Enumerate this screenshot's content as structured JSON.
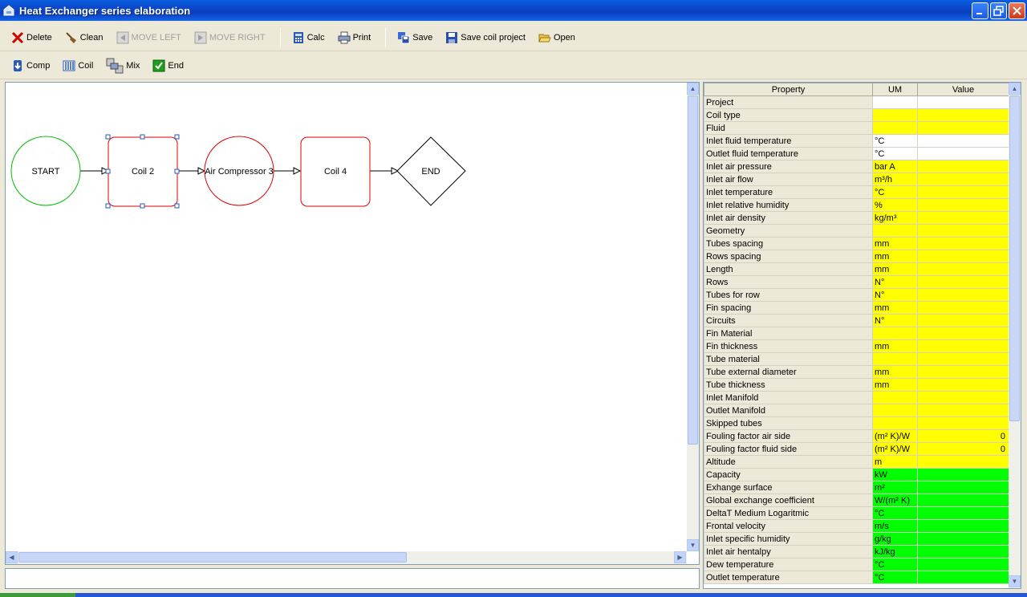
{
  "window": {
    "title": "Heat Exchanger series elaboration"
  },
  "toolbar1": [
    {
      "label": "Delete",
      "icon": "delete-icon",
      "enabled": true
    },
    {
      "label": "Clean",
      "icon": "broom-icon",
      "enabled": true
    },
    {
      "label": "MOVE LEFT",
      "icon": "move-left-icon",
      "enabled": false
    },
    {
      "label": "MOVE RIGHT",
      "icon": "move-right-icon",
      "enabled": false
    },
    {
      "label": "Calc",
      "icon": "calculator-icon",
      "enabled": true
    },
    {
      "label": "Print",
      "icon": "printer-icon",
      "enabled": true
    },
    {
      "label": "Save",
      "icon": "save-icon",
      "enabled": true
    },
    {
      "label": "Save coil project",
      "icon": "floppy-icon",
      "enabled": true
    },
    {
      "label": "Open",
      "icon": "folder-open-icon",
      "enabled": true
    }
  ],
  "toolbar2": [
    {
      "label": "Comp",
      "icon": "compressor-icon"
    },
    {
      "label": "Coil",
      "icon": "coil-icon"
    },
    {
      "label": "Mix",
      "icon": "mix-icon"
    },
    {
      "label": "End",
      "icon": "end-check-icon"
    }
  ],
  "diagram": {
    "nodes": [
      {
        "label": "START",
        "shape": "circle",
        "color": "#00c000"
      },
      {
        "label": "Coil 2",
        "shape": "rounded-rect",
        "color": "#e00000",
        "selected": true
      },
      {
        "label": "Air Compressor 3",
        "shape": "circle",
        "color": "#e00000"
      },
      {
        "label": "Coil 4",
        "shape": "rounded-rect",
        "color": "#e00000"
      },
      {
        "label": "END",
        "shape": "diamond",
        "color": "#000000"
      }
    ]
  },
  "grid": {
    "headers": {
      "property": "Property",
      "um": "UM",
      "value": "Value"
    },
    "rows": [
      {
        "property": "Project",
        "um": "",
        "value": "",
        "color": "white"
      },
      {
        "property": "Coil type",
        "um": "",
        "value": "",
        "color": "yellow"
      },
      {
        "property": "Fluid",
        "um": "",
        "value": "",
        "color": "yellow"
      },
      {
        "property": "Inlet fluid temperature",
        "um": "°C",
        "value": "",
        "color": "white"
      },
      {
        "property": "Outlet fluid temperature",
        "um": "°C",
        "value": "",
        "color": "white"
      },
      {
        "property": "Inlet air pressure",
        "um": "bar A",
        "value": "",
        "color": "yellow"
      },
      {
        "property": "Inlet air flow",
        "um": "m³/h",
        "value": "",
        "color": "yellow"
      },
      {
        "property": "Inlet temperature",
        "um": "°C",
        "value": "",
        "color": "yellow"
      },
      {
        "property": "Inlet relative humidity",
        "um": "%",
        "value": "",
        "color": "yellow"
      },
      {
        "property": "Inlet air density",
        "um": "kg/m³",
        "value": "",
        "color": "yellow"
      },
      {
        "property": "Geometry",
        "um": "",
        "value": "",
        "color": "yellow"
      },
      {
        "property": "Tubes spacing",
        "um": "mm",
        "value": "",
        "color": "yellow"
      },
      {
        "property": "Rows spacing",
        "um": "mm",
        "value": "",
        "color": "yellow"
      },
      {
        "property": "Length",
        "um": "mm",
        "value": "",
        "color": "yellow"
      },
      {
        "property": "Rows",
        "um": "N°",
        "value": "",
        "color": "yellow"
      },
      {
        "property": "Tubes for row",
        "um": "N°",
        "value": "",
        "color": "yellow"
      },
      {
        "property": "Fin spacing",
        "um": "mm",
        "value": "",
        "color": "yellow"
      },
      {
        "property": "Circuits",
        "um": "N°",
        "value": "",
        "color": "yellow"
      },
      {
        "property": "Fin Material",
        "um": "",
        "value": "",
        "color": "yellow"
      },
      {
        "property": "Fin thickness",
        "um": "mm",
        "value": "",
        "color": "yellow"
      },
      {
        "property": "Tube material",
        "um": "",
        "value": "",
        "color": "yellow"
      },
      {
        "property": "Tube external diameter",
        "um": "mm",
        "value": "",
        "color": "yellow"
      },
      {
        "property": "Tube thickness",
        "um": "mm",
        "value": "",
        "color": "yellow"
      },
      {
        "property": "Inlet Manifold",
        "um": "",
        "value": "",
        "color": "yellow"
      },
      {
        "property": "Outlet Manifold",
        "um": "",
        "value": "",
        "color": "yellow"
      },
      {
        "property": "Skipped tubes",
        "um": "",
        "value": "",
        "color": "yellow"
      },
      {
        "property": "Fouling factor air side",
        "um": "(m² K)/W",
        "value": "0",
        "color": "yellow"
      },
      {
        "property": "Fouling factor fluid side",
        "um": "(m² K)/W",
        "value": "0",
        "color": "yellow"
      },
      {
        "property": "Altitude",
        "um": "m",
        "value": "",
        "color": "yellow"
      },
      {
        "property": "Capacity",
        "um": "kW",
        "value": "",
        "color": "green"
      },
      {
        "property": "Exhange surface",
        "um": "m²",
        "value": "",
        "color": "green"
      },
      {
        "property": "Global exchange coefficient",
        "um": "W/(m² K)",
        "value": "",
        "color": "green"
      },
      {
        "property": "DeltaT Medium Logaritmic",
        "um": "°C",
        "value": "",
        "color": "green"
      },
      {
        "property": "Frontal velocity",
        "um": "m/s",
        "value": "",
        "color": "green"
      },
      {
        "property": "Inlet specific humidity",
        "um": "g/kg",
        "value": "",
        "color": "green"
      },
      {
        "property": "Inlet air hentalpy",
        "um": "kJ/kg",
        "value": "",
        "color": "green"
      },
      {
        "property": "Dew temperature",
        "um": "°C",
        "value": "",
        "color": "green"
      },
      {
        "property": "Outlet temperature",
        "um": "°C",
        "value": "",
        "color": "green"
      }
    ]
  }
}
